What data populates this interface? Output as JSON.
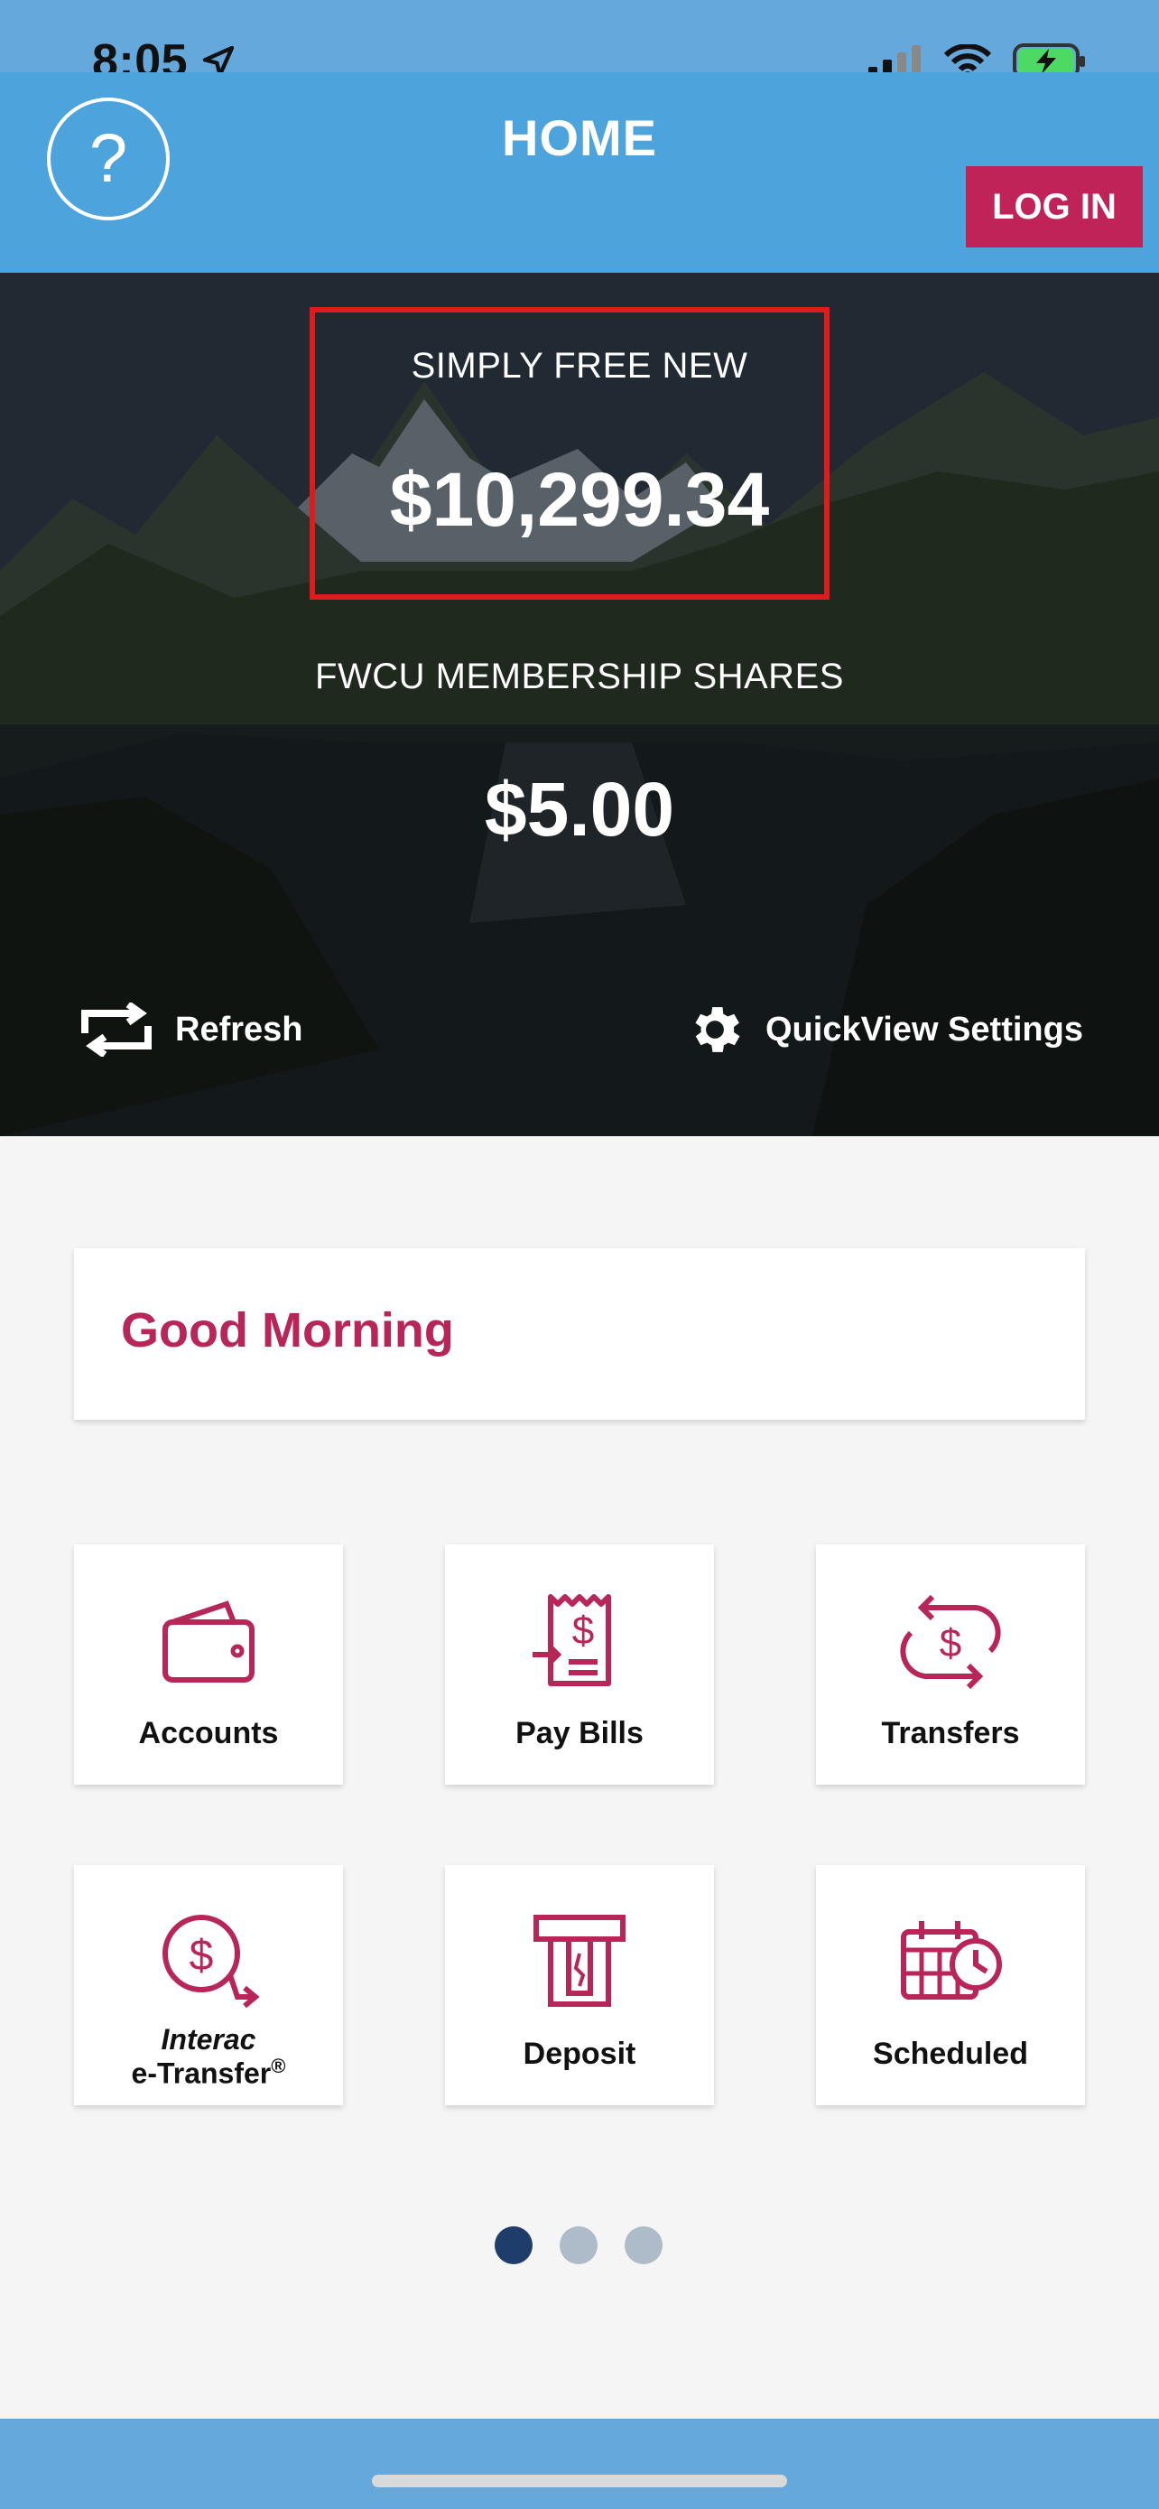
{
  "status_bar": {
    "time": "8:05",
    "icons": [
      "location-arrow-icon",
      "cellular-signal-icon",
      "wifi-icon",
      "battery-charging-icon"
    ]
  },
  "header": {
    "title": "HOME",
    "help_icon": "question-mark-icon",
    "help_label": "?",
    "login_label": "LOG IN"
  },
  "quickview": {
    "accounts": [
      {
        "name": "SIMPLY FREE NEW",
        "balance": "$10,299.34",
        "highlighted": true
      },
      {
        "name": "FWCU MEMBERSHIP SHARES",
        "balance": "$5.00",
        "highlighted": false
      }
    ],
    "refresh_label": "Refresh",
    "settings_label": "QuickView Settings"
  },
  "greeting": "Good Morning",
  "tiles": [
    {
      "label": "Accounts",
      "icon": "wallet-icon"
    },
    {
      "label": "Pay Bills",
      "icon": "bill-receipt-icon"
    },
    {
      "label": "Transfers",
      "icon": "transfer-dollar-icon"
    },
    {
      "label_italic": "Interac",
      "label_line2": "e-Transfer",
      "label_mark": "®",
      "icon": "etransfer-icon"
    },
    {
      "label": "Deposit",
      "icon": "deposit-icon"
    },
    {
      "label": "Scheduled",
      "icon": "calendar-clock-icon"
    }
  ],
  "pagination": {
    "pages": 3,
    "current": 1
  },
  "colors": {
    "header_blue": "#4da3dc",
    "login_red": "#c02358",
    "accent_magenta": "#b82658",
    "highlight_border": "#e11b1b",
    "dot_active": "#1e3d6b",
    "dot_inactive": "#aebbc9"
  }
}
